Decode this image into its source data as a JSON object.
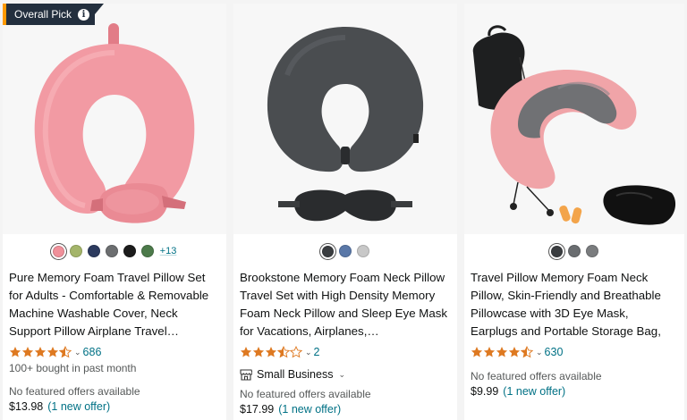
{
  "products": [
    {
      "badge": {
        "label": "Overall Pick",
        "info_icon": "info-icon"
      },
      "swatches": [
        "#f0909a",
        "#a4b56a",
        "#2c3a5e",
        "#6c6e70",
        "#1c1c1c",
        "#4c7a4a"
      ],
      "more_swatches": "+13",
      "title": "Pure Memory Foam Travel Pillow Set for Adults - Comfortable & Removable Machine Washable Cover, Neck Support Pillow Airplane Travel…",
      "rating": 4.5,
      "rating_count": "686",
      "bought": "100+ bought in past month",
      "no_offers": "No featured offers available",
      "price": "$13.98",
      "new_offer": "(1 new offer)"
    },
    {
      "swatches": [
        "#3a3d40",
        "#5a78a8",
        "#c8c8c8"
      ],
      "title": "Brookstone Memory Foam Neck Pillow Travel Set with High Density Memory Foam Neck Pillow and Sleep Eye Mask for Vacations, Airplanes,…",
      "rating": 3.5,
      "rating_count": "2",
      "seller": {
        "label": "Small Business",
        "icon": "small-business-icon"
      },
      "no_offers": "No featured offers available",
      "price": "$17.99",
      "new_offer": "(1 new offer)"
    },
    {
      "swatches": [
        "#3a3d40",
        "#6a6d70",
        "#7a7c7e"
      ],
      "title": "Travel Pillow Memory Foam Neck Pillow, Skin-Friendly and Breathable Pillowcase with 3D Eye Mask, Earplugs and Portable Storage Bag, Suitable…",
      "rating": 4.5,
      "rating_count": "630",
      "no_offers": "No featured offers available",
      "price": "$9.99",
      "new_offer": "(1 new offer)"
    }
  ],
  "colors": {
    "star": "#de7921",
    "link": "#007185",
    "badge_bg": "#232f3e",
    "badge_accent": "#ff9900"
  }
}
